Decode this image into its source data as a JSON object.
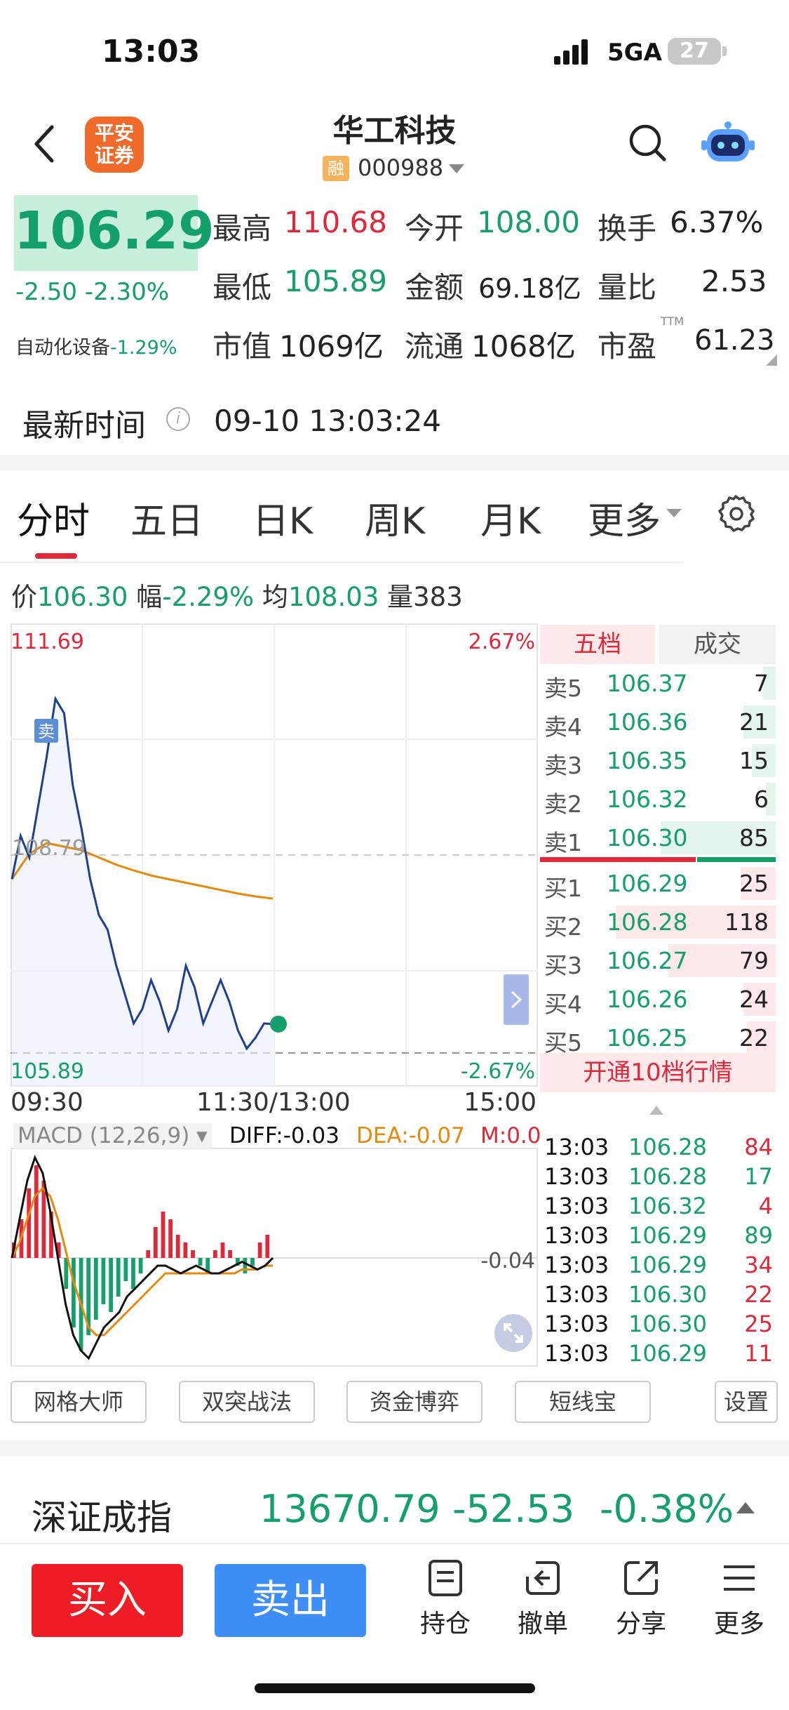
{
  "status_bar": {
    "time": "13:03",
    "network": "5GA",
    "battery": "27"
  },
  "header": {
    "title": "华工科技",
    "rong_badge": "融",
    "code": "000988"
  },
  "quote": {
    "price": "106.29",
    "change": "-2.50",
    "change_pct": "-2.30%",
    "sector_label": "自动化设备",
    "sector_pct": "-1.29%",
    "high_label": "最高",
    "high": "110.68",
    "open_label": "今开",
    "open": "108.00",
    "turnover_label": "换手",
    "turnover": "6.37%",
    "low_label": "最低",
    "low": "105.89",
    "amount_label": "金额",
    "amount": "69.18亿",
    "vol_ratio_label": "量比",
    "vol_ratio": "2.53",
    "mcap_label": "市值",
    "mcap": "1069亿",
    "float_label": "流通",
    "float": "1068亿",
    "pe_label": "市盈",
    "pe_sup": "TTM",
    "pe": "61.23"
  },
  "latest": {
    "label": "最新时间",
    "info_icon": "i",
    "time": "09-10 13:03:24"
  },
  "tabs": {
    "t1": "分时",
    "t2": "五日",
    "t3": "日K",
    "t4": "周K",
    "t5": "月K",
    "t6": "更多"
  },
  "info_line": {
    "price_label": "价",
    "price": "106.30",
    "amp_label": "幅",
    "amp": "-2.29%",
    "avg_label": "均",
    "avg": "108.03",
    "vol_label": "量",
    "vol": "383"
  },
  "chart_data": {
    "type": "line",
    "title": "",
    "y_top": "111.69",
    "y_bottom": "105.89",
    "pct_top": "2.67%",
    "pct_bottom": "-2.67%",
    "ylim": [
      105.89,
      111.69
    ],
    "x_labels": [
      "09:30",
      "11:30/13:00",
      "15:00"
    ],
    "mid_label": "108.79",
    "sell_marker": "卖",
    "series": [
      {
        "name": "price",
        "values": [
          108.3,
          108.9,
          108.6,
          109.3,
          110.0,
          110.8,
          110.6,
          109.6,
          109.0,
          108.3,
          107.8,
          107.6,
          107.1,
          106.7,
          106.3,
          106.5,
          106.9,
          106.6,
          106.2,
          106.5,
          107.1,
          106.8,
          106.3,
          106.6,
          106.9,
          106.6,
          106.2,
          105.95,
          106.1,
          106.3,
          106.29
        ]
      },
      {
        "name": "avg",
        "values": [
          108.3,
          108.65,
          108.8,
          108.75,
          108.7,
          108.6,
          108.5,
          108.42,
          108.35,
          108.3,
          108.25,
          108.2,
          108.15,
          108.1,
          108.06,
          108.03
        ]
      }
    ],
    "macd": {
      "label": "MACD (12,26,9)",
      "diff_label": "DIFF:",
      "diff": "-0.03",
      "dea_label": "DEA:",
      "dea": "-0.07",
      "m_label": "M:",
      "m": "0.0",
      "axis_label": "-0.04",
      "hist": [
        0.02,
        0.05,
        0.09,
        0.12,
        0.1,
        0.06,
        0.02,
        -0.04,
        -0.09,
        -0.12,
        -0.1,
        -0.08,
        -0.06,
        -0.07,
        -0.05,
        -0.03,
        -0.04,
        -0.02,
        0.01,
        0.04,
        0.06,
        0.05,
        0.03,
        0.02,
        0.01,
        -0.01,
        -0.02,
        0.01,
        0.02,
        0.01,
        -0.01,
        -0.02,
        -0.01,
        0.02,
        0.03
      ],
      "diff_line": [
        0,
        0.05,
        0.1,
        0.13,
        0.11,
        0.06,
        0.0,
        -0.06,
        -0.1,
        -0.12,
        -0.13,
        -0.11,
        -0.09,
        -0.08,
        -0.07,
        -0.05,
        -0.04,
        -0.03,
        -0.02,
        -0.01,
        -0.01,
        -0.015,
        -0.02,
        -0.015,
        -0.01,
        -0.015,
        -0.02,
        -0.02,
        -0.015,
        -0.01,
        -0.005,
        -0.01,
        -0.015,
        -0.01,
        0.0
      ],
      "dea_line": [
        0,
        0.02,
        0.05,
        0.08,
        0.09,
        0.08,
        0.05,
        0.01,
        -0.03,
        -0.06,
        -0.09,
        -0.1,
        -0.1,
        -0.09,
        -0.08,
        -0.07,
        -0.06,
        -0.05,
        -0.04,
        -0.03,
        -0.02,
        -0.02,
        -0.02,
        -0.02,
        -0.02,
        -0.02,
        -0.02,
        -0.02,
        -0.02,
        -0.02,
        -0.015,
        -0.015,
        -0.015,
        -0.01,
        -0.01
      ]
    }
  },
  "order_book": {
    "tab_five": "五档",
    "tab_trades": "成交",
    "asks": [
      {
        "label": "卖5",
        "price": "106.37",
        "vol": "7",
        "bar": 0.08
      },
      {
        "label": "卖4",
        "price": "106.36",
        "vol": "21",
        "bar": 0.2
      },
      {
        "label": "卖3",
        "price": "106.35",
        "vol": "15",
        "bar": 0.15
      },
      {
        "label": "卖2",
        "price": "106.32",
        "vol": "6",
        "bar": 0.06
      },
      {
        "label": "卖1",
        "price": "106.30",
        "vol": "85",
        "bar": 0.72
      }
    ],
    "bids": [
      {
        "label": "买1",
        "price": "106.29",
        "vol": "25",
        "bar": 0.22
      },
      {
        "label": "买2",
        "price": "106.28",
        "vol": "118",
        "bar": 1.0
      },
      {
        "label": "买3",
        "price": "106.27",
        "vol": "79",
        "bar": 0.67
      },
      {
        "label": "买4",
        "price": "106.26",
        "vol": "24",
        "bar": 0.2
      },
      {
        "label": "买5",
        "price": "106.25",
        "vol": "22",
        "bar": 0.18
      }
    ],
    "upgrade": "开通10档行情"
  },
  "ticks": [
    {
      "time": "13:03",
      "price": "106.28",
      "vol": "84",
      "dir": "red"
    },
    {
      "time": "13:03",
      "price": "106.28",
      "vol": "17",
      "dir": "green"
    },
    {
      "time": "13:03",
      "price": "106.32",
      "vol": "4",
      "dir": "red"
    },
    {
      "time": "13:03",
      "price": "106.29",
      "vol": "89",
      "dir": "green"
    },
    {
      "time": "13:03",
      "price": "106.29",
      "vol": "34",
      "dir": "red"
    },
    {
      "time": "13:03",
      "price": "106.30",
      "vol": "22",
      "dir": "red"
    },
    {
      "time": "13:03",
      "price": "106.30",
      "vol": "25",
      "dir": "red"
    },
    {
      "time": "13:03",
      "price": "106.29",
      "vol": "11",
      "dir": "red"
    }
  ],
  "tools": {
    "b1": "网格大师",
    "b2": "双突战法",
    "b3": "资金博弈",
    "b4": "短线宝",
    "b5": "设置"
  },
  "index": {
    "name": "深证成指",
    "value": "13670.79",
    "change": "-52.53",
    "pct": "-0.38%"
  },
  "bottom": {
    "buy": "买入",
    "sell": "卖出",
    "hold": "持仓",
    "cancel": "撤单",
    "share": "分享",
    "more": "更多"
  },
  "colors": {
    "up": "#e0283a",
    "down": "#14a06a",
    "price_line": "#1f3f8f",
    "avg_line": "#e8890c",
    "buy_btn": "#ee1c24",
    "sell_btn": "#3d8ef6"
  }
}
